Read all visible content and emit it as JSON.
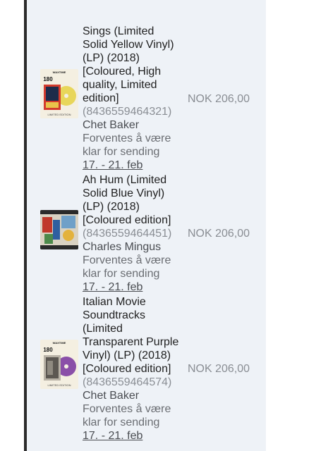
{
  "items": [
    {
      "title_lines": [
        "Sings (Limited",
        "Solid Yellow Vinyl)",
        "(LP) (2018)",
        "[Coloured, High",
        "quality, Limited",
        "edition]"
      ],
      "sku": "(8436559464321)",
      "artist": "Chet Baker",
      "shipping_lines": [
        "Forventes å være",
        "klar for sending"
      ],
      "date": "17. - 21. feb",
      "price": "NOK 206,00",
      "thumb_logo": "WAXTIME",
      "thumb_badge": "180",
      "thumb_caption": "LIMITED EDITION",
      "vinyl_color": "#e8d65a"
    },
    {
      "title_lines": [
        "Ah Hum (Limited",
        "Solid Blue Vinyl)",
        "(LP) (2018)",
        "[Coloured edition]"
      ],
      "sku": "(8436559464451)",
      "artist": "Charles Mingus",
      "shipping_lines": [
        "Forventes å være",
        "klar for sending"
      ],
      "date": "17. - 21. feb",
      "price": "NOK 206,00",
      "vinyl_color": "#3d6fb3"
    },
    {
      "title_lines": [
        "Italian Movie",
        "Soundtracks",
        "(Limited",
        "Transparent Purple",
        "Vinyl) (LP) (2018)",
        "[Coloured edition]"
      ],
      "sku": "(8436559464574)",
      "artist": "Chet Baker",
      "shipping_lines": [
        "Forventes å være",
        "klar for sending"
      ],
      "date": "17. - 21. feb",
      "price": "NOK 206,00",
      "thumb_logo": "WAXTIME",
      "thumb_badge": "180",
      "thumb_caption": "LIMITED EDITION",
      "vinyl_color": "#8a4fa8"
    }
  ]
}
